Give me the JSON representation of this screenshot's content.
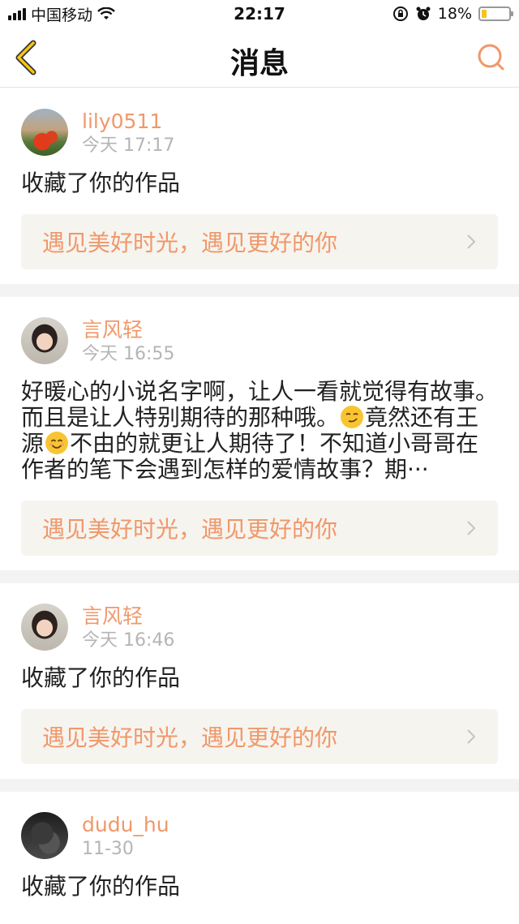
{
  "status_bar": {
    "carrier": "中国移动",
    "time": "22:17",
    "battery_percent": "18%",
    "battery_level": 0.18,
    "icons": [
      "signal-icon",
      "wifi-icon",
      "lock-rotation-icon",
      "alarm-icon",
      "battery-icon"
    ]
  },
  "nav": {
    "title": "消息",
    "back_icon": "chevron-left-icon",
    "search_icon": "search-icon",
    "accent_color": "#f0986a"
  },
  "messages": [
    {
      "username": "lily0511",
      "time": "今天 17:17",
      "text": "收藏了你的作品",
      "work_title": "遇见美好时光，遇见更好的你"
    },
    {
      "username": "言风轻",
      "time": "今天 16:55",
      "text_parts": {
        "a": "好暖心的小说名字啊，让人一看就觉得有故事。而且是让人特别期待的那种哦。",
        "b": "竟然还有王源",
        "c": "不由的就更让人期待了！不知道小哥哥在作者的笔下会遇到怎样的爱情故事？期···"
      },
      "emojis": [
        "smirk-emoji",
        "smile-emoji"
      ],
      "work_title": "遇见美好时光，遇见更好的你"
    },
    {
      "username": "言风轻",
      "time": "今天 16:46",
      "text": "收藏了你的作品",
      "work_title": "遇见美好时光，遇见更好的你"
    },
    {
      "username": "dudu_hu",
      "time": "11-30",
      "text": "收藏了你的作品"
    }
  ]
}
